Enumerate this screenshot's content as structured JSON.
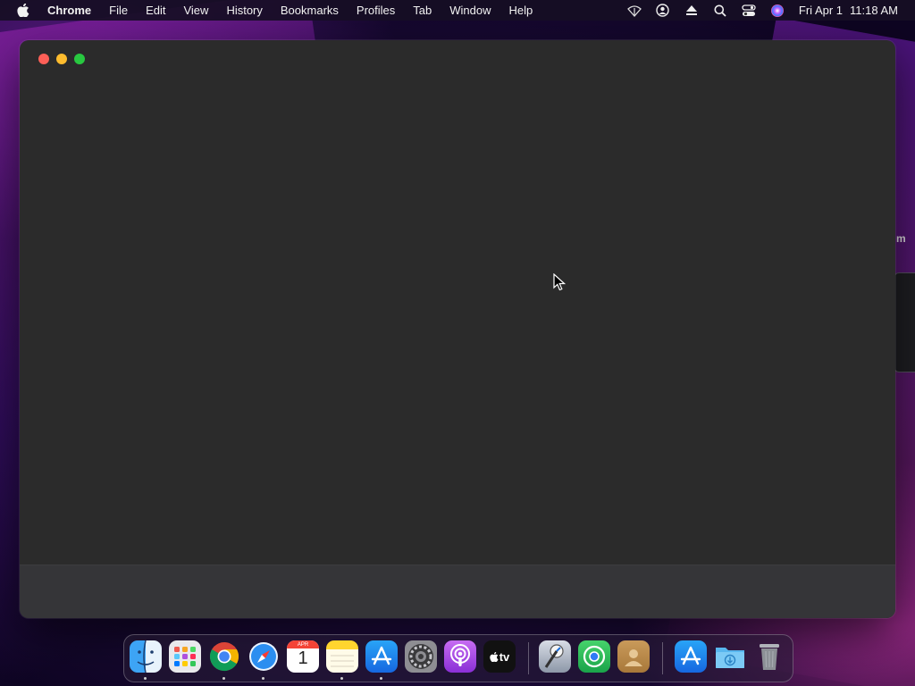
{
  "menubar": {
    "apple_icon": "apple-logo",
    "app_name": "Chrome",
    "items": [
      "File",
      "Edit",
      "View",
      "History",
      "Bookmarks",
      "Profiles",
      "Tab",
      "Window",
      "Help"
    ],
    "status_icons": [
      "wifi-icon",
      "user-account-icon",
      "eject-icon",
      "search-icon",
      "control-center-icon",
      "siri-icon"
    ],
    "clock": {
      "date": "Fri Apr 1",
      "time": "11:18 AM"
    }
  },
  "window": {
    "app": "Chrome",
    "background": "#2b2b2b",
    "traffic_lights": {
      "close": "#fe5f57",
      "minimize": "#febc2e",
      "zoom": "#28c840"
    }
  },
  "background_window": {
    "label": "m"
  },
  "dock": {
    "items": [
      {
        "name": "Finder",
        "icon": "finder-icon",
        "running": true
      },
      {
        "name": "Launchpad",
        "icon": "launchpad-icon",
        "running": false
      },
      {
        "name": "Google Chrome",
        "icon": "chrome-icon",
        "running": true
      },
      {
        "name": "Safari",
        "icon": "safari-icon",
        "running": true
      },
      {
        "name": "Calendar",
        "icon": "calendar-icon",
        "running": false,
        "month": "APR",
        "day": "1"
      },
      {
        "name": "Notes",
        "icon": "notes-icon",
        "running": true
      },
      {
        "name": "App Store",
        "icon": "app-store-icon",
        "running": true
      },
      {
        "name": "System Preferences",
        "icon": "system-preferences-icon",
        "running": false
      },
      {
        "name": "Podcasts",
        "icon": "podcasts-icon",
        "running": false
      },
      {
        "name": "TV",
        "icon": "apple-tv-icon",
        "running": false,
        "label": "tv"
      },
      {
        "name": "Xcode Instruments",
        "icon": "instruments-icon",
        "running": false
      },
      {
        "name": "Find My",
        "icon": "find-my-icon",
        "running": false
      },
      {
        "name": "Contacts",
        "icon": "contacts-icon",
        "running": false
      },
      {
        "name": "App Store",
        "icon": "app-store-folder-icon",
        "running": false
      },
      {
        "name": "Downloads",
        "icon": "downloads-folder-icon",
        "running": false
      },
      {
        "name": "Trash",
        "icon": "trash-icon",
        "running": false
      }
    ]
  }
}
